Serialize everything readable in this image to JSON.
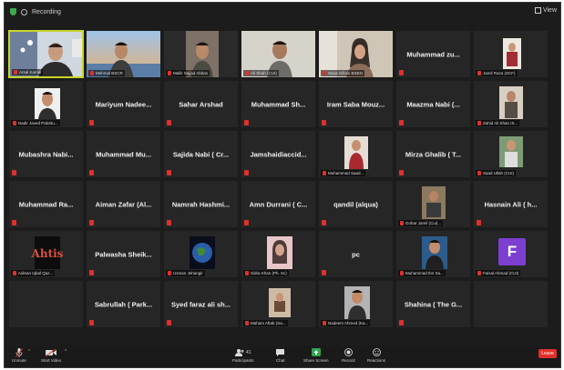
{
  "topbar": {
    "recording_text": "Recording",
    "view_label": "View"
  },
  "tiles": [
    {
      "type": "video",
      "photo": "p1",
      "label": "Arsal Kamal"
    },
    {
      "type": "video",
      "photo": "p2",
      "label": "Mehmal BSCR"
    },
    {
      "type": "video",
      "photo": "p3",
      "label": "Malik Sajjad Abbas"
    },
    {
      "type": "video",
      "photo": "p4",
      "label": "Ali Shah (CUI)"
    },
    {
      "type": "video",
      "photo": "p5",
      "label": "Sana Gillani BSEN"
    },
    {
      "type": "name",
      "name": "Muhammad zu..."
    },
    {
      "type": "video",
      "photo": "p6",
      "label": "Jamil Raza (SCF)"
    },
    {
      "type": "video",
      "photo": "p7",
      "label": "Nadir Javed PakStu..."
    },
    {
      "type": "name",
      "name": "Mariyum Nadee..."
    },
    {
      "type": "name",
      "name": "Sahar Arshad"
    },
    {
      "type": "name",
      "name": "Muhammad Sh..."
    },
    {
      "type": "name",
      "name": "Iram Saba Mouz..."
    },
    {
      "type": "name",
      "name": "Maazma Nabi (..."
    },
    {
      "type": "video",
      "photo": "p8",
      "label": "Zahid Ali Khan IS..."
    },
    {
      "type": "name",
      "name": "Mubashra Nabi..."
    },
    {
      "type": "name",
      "name": "Muhammad Mu..."
    },
    {
      "type": "name",
      "name": "Sajida Nabi ( Cr..."
    },
    {
      "type": "name",
      "name": "Jamshaidiaccid..."
    },
    {
      "type": "video",
      "photo": "p9",
      "label": "Muhammad Saad..."
    },
    {
      "type": "name",
      "name": "Mirza Ghalib ( T..."
    },
    {
      "type": "video",
      "photo": "p10",
      "label": "Saad Ullah (CUI)"
    },
    {
      "type": "name",
      "name": "Muhammad Ra..."
    },
    {
      "type": "name",
      "name": "Aiman Zafar (Al..."
    },
    {
      "type": "name",
      "name": "Namrah Hashmi..."
    },
    {
      "type": "name",
      "name": "Amn Durrani ( C..."
    },
    {
      "type": "name",
      "name": "qandil (alqua)"
    },
    {
      "type": "video",
      "photo": "p11",
      "label": "Gohar Jamil (Cui)..."
    },
    {
      "type": "name",
      "name": "Hasnain Ali ( h..."
    },
    {
      "type": "video",
      "photo": "p12",
      "label": "Adinan Iqbal Qaz..."
    },
    {
      "type": "name",
      "name": "Palwasha Sheik..."
    },
    {
      "type": "video",
      "photo": "p13",
      "label": "Usman Jehangir"
    },
    {
      "type": "video",
      "photo": "p14",
      "label": "Sidra Khan (Ph. Sc)"
    },
    {
      "type": "name",
      "name": "pc"
    },
    {
      "type": "video",
      "photo": "p15",
      "label": "Muhammad Ibn Sa..."
    },
    {
      "type": "avatar",
      "letter": "F",
      "label": "Faisal Ahmad (CUI)"
    },
    {
      "type": "empty"
    },
    {
      "type": "name",
      "name": "Sabrullah ( Park..."
    },
    {
      "type": "name",
      "name": "Syed faraz ali sh..."
    },
    {
      "type": "video",
      "photo": "p16",
      "label": "Maham Aftab (Sa..."
    },
    {
      "type": "video",
      "photo": "p17",
      "label": "Nadeem Ahmed (Ka..."
    },
    {
      "type": "name",
      "name": "Shahina ( The G..."
    },
    {
      "type": "empty"
    }
  ],
  "toolbar": {
    "unmute_label": "Unmute",
    "video_label": "Start Video",
    "participants_label": "Participants",
    "participants_count": "41",
    "chat_label": "Chat",
    "share_label": "Share Screen",
    "record_label": "Record",
    "reactions_label": "Reactions",
    "end_label": "Leave"
  }
}
